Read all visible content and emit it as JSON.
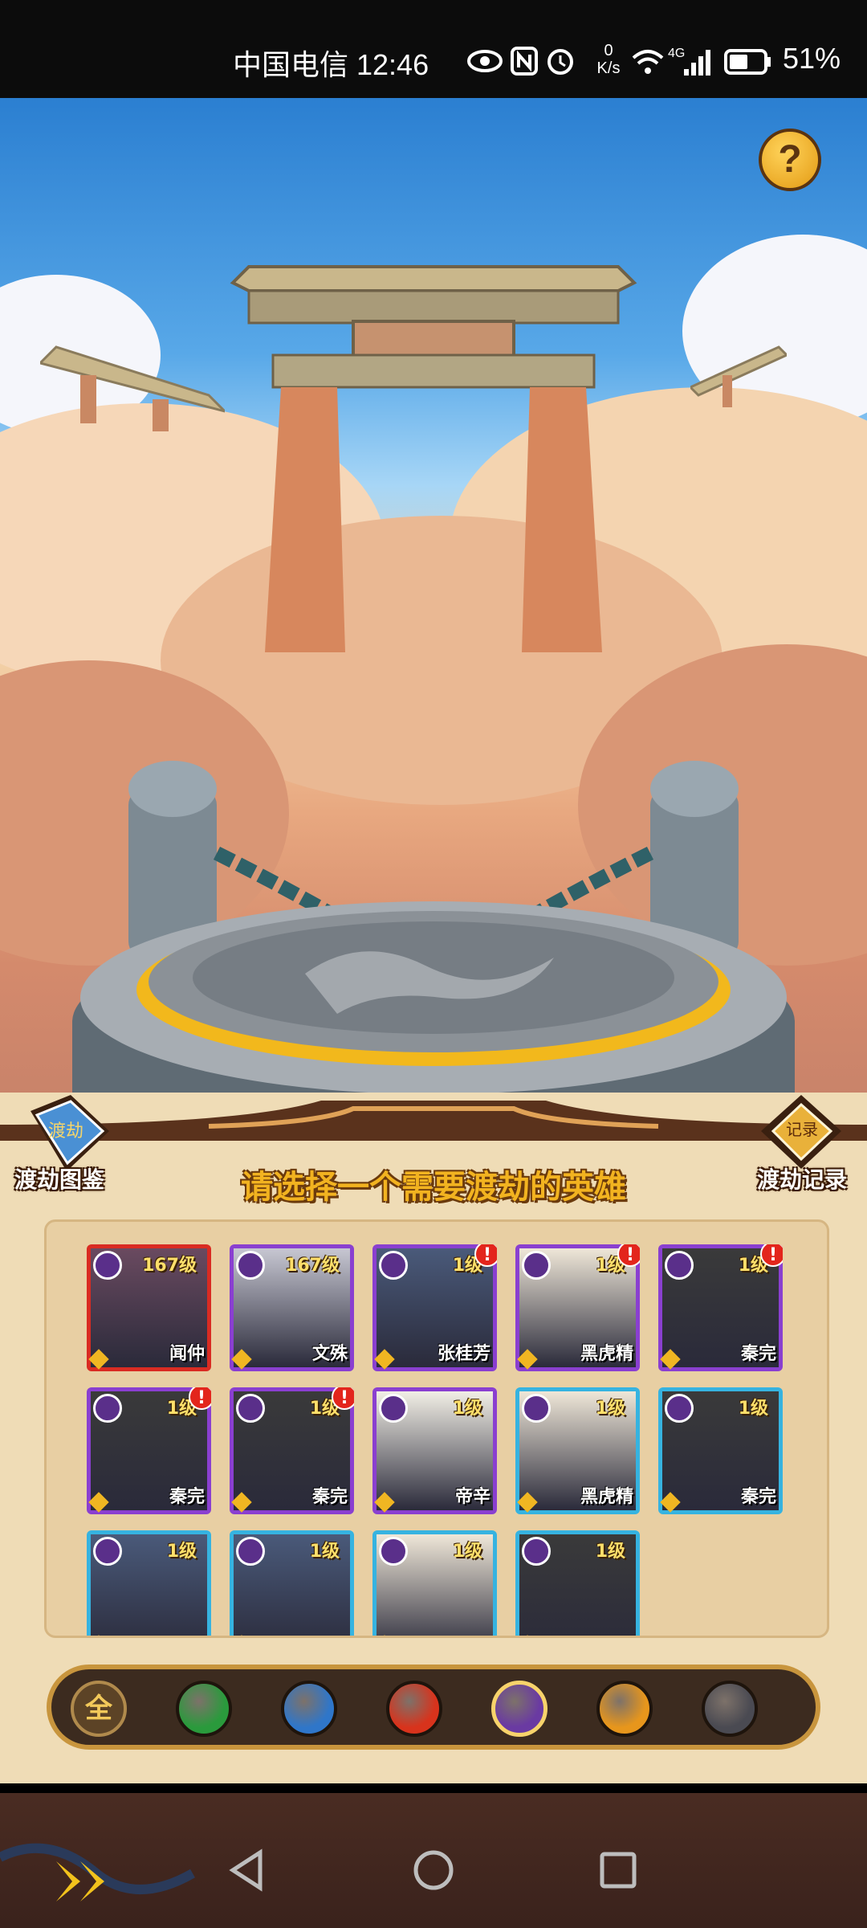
{
  "status_bar": {
    "carrier_time": "中国电信 12:46",
    "net_speed_value": "0",
    "net_speed_unit": "K/s",
    "network_type": "4G",
    "battery_percent": "51%"
  },
  "side_buttons": {
    "left_label": "渡劫图鉴",
    "right_label": "渡劫记录",
    "book_text": "渡劫",
    "scroll_text": "记录"
  },
  "headline": "请选择一个需要渡劫的英雄",
  "heroes": [
    {
      "name": "闻仲",
      "level": "167级",
      "frame": "red",
      "alert": false
    },
    {
      "name": "文殊",
      "level": "167级",
      "frame": "purple",
      "alert": false
    },
    {
      "name": "张桂芳",
      "level": "1级",
      "frame": "purple",
      "alert": true
    },
    {
      "name": "黑虎精",
      "level": "1级",
      "frame": "purple",
      "alert": true
    },
    {
      "name": "秦完",
      "level": "1级",
      "frame": "purple",
      "alert": true
    },
    {
      "name": "秦完",
      "level": "1级",
      "frame": "purple",
      "alert": true
    },
    {
      "name": "秦完",
      "level": "1级",
      "frame": "purple",
      "alert": true
    },
    {
      "name": "帝辛",
      "level": "1级",
      "frame": "purple",
      "alert": false
    },
    {
      "name": "黑虎精",
      "level": "1级",
      "frame": "blue",
      "alert": false
    },
    {
      "name": "秦完",
      "level": "1级",
      "frame": "blue",
      "alert": false
    },
    {
      "name": "",
      "level": "1级",
      "frame": "blue",
      "alert": false
    },
    {
      "name": "",
      "level": "1级",
      "frame": "blue",
      "alert": false
    },
    {
      "name": "",
      "level": "1级",
      "frame": "blue",
      "alert": false
    },
    {
      "name": "",
      "level": "1级",
      "frame": "blue",
      "alert": false
    }
  ],
  "filters": [
    {
      "label": "全",
      "icon": "all-text-icon",
      "color": "#6b5230"
    },
    {
      "label": "",
      "icon": "leaf-element-icon",
      "color": "#2a9a3c"
    },
    {
      "label": "",
      "icon": "water-element-icon",
      "color": "#2f76c9"
    },
    {
      "label": "",
      "icon": "fire-element-icon",
      "color": "#d8331c"
    },
    {
      "label": "",
      "icon": "moon-element-icon",
      "color": "#6a3aa2"
    },
    {
      "label": "",
      "icon": "sun-element-icon",
      "color": "#e7961c"
    },
    {
      "label": "",
      "icon": "swirl-element-icon",
      "color": "#4a4a52"
    }
  ],
  "help_label": "?"
}
